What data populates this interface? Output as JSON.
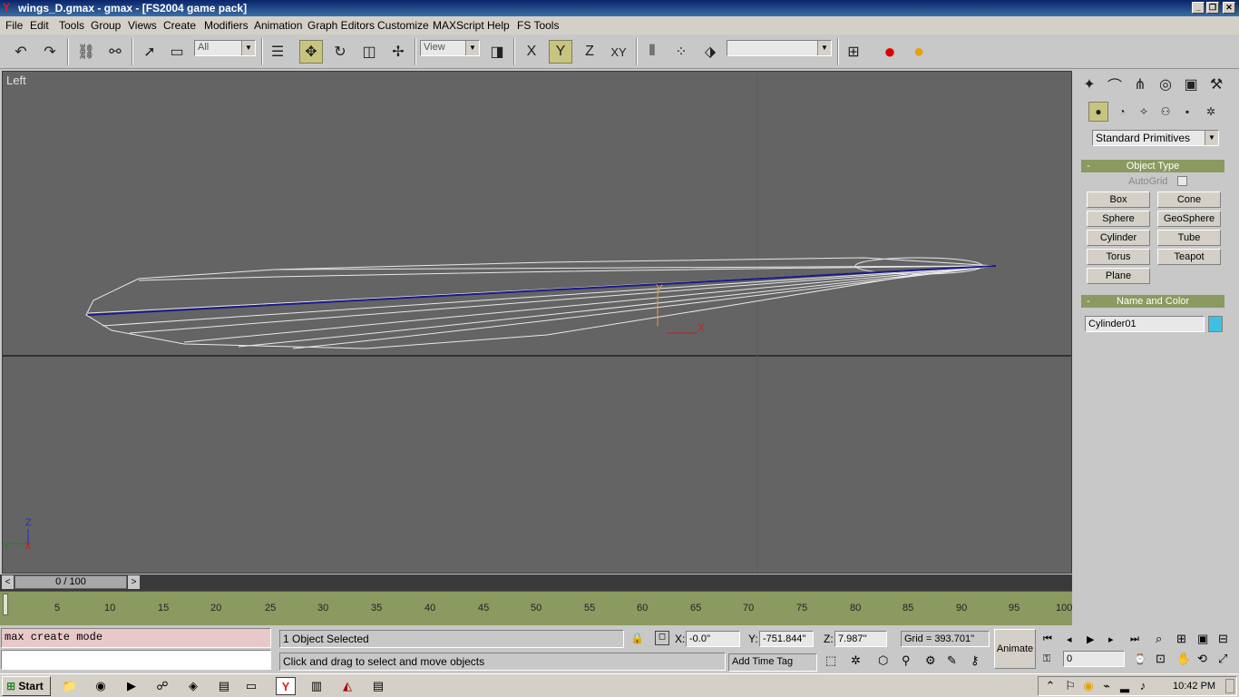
{
  "window": {
    "title": "wings_D.gmax - gmax - [FS2004 game pack]",
    "min_btn": "_",
    "max_btn": "❐",
    "close_btn": "✕"
  },
  "menu": [
    "File",
    "Edit",
    "Tools",
    "Group",
    "Views",
    "Create",
    "Modifiers",
    "Animation",
    "Graph Editors",
    "Customize",
    "MAXScript",
    "Help",
    "FS Tools"
  ],
  "toolbar": {
    "selection_filter": "All",
    "ref_coord": "View",
    "named_selection": "",
    "axis_x": "X",
    "axis_y": "Y",
    "axis_z": "Z",
    "axis_xy": "XY"
  },
  "viewport": {
    "label": "Left",
    "gizmo_y": "Y",
    "gizmo_x": "X",
    "axis_z": "Z",
    "axis_x": "X",
    "axis_y": "Y"
  },
  "command_panel": {
    "category_dropdown": "Standard Primitives",
    "object_type_header": "Object Type",
    "autogrid_label": "AutoGrid",
    "buttons": [
      "Box",
      "Cone",
      "Sphere",
      "GeoSphere",
      "Cylinder",
      "Tube",
      "Torus",
      "Teapot",
      "Plane"
    ],
    "name_color_header": "Name and Color",
    "object_name": "Cylinder01",
    "object_color": "#40c0e0",
    "collapse": "-"
  },
  "time": {
    "slider_text": "0 / 100",
    "prev": "<",
    "next": ">",
    "ticks": [
      "5",
      "10",
      "15",
      "20",
      "25",
      "30",
      "35",
      "40",
      "45",
      "50",
      "55",
      "60",
      "65",
      "70",
      "75",
      "80",
      "85",
      "90",
      "95",
      "100"
    ]
  },
  "status": {
    "listener_text": "max create mode",
    "selection_info": "1 Object Selected",
    "prompt": "Click and drag to select and move objects",
    "x_label": "X:",
    "x_value": "-0.0''",
    "y_label": "Y:",
    "y_value": "-751.844''",
    "z_label": "Z:",
    "z_value": "7.987''",
    "grid": "Grid = 393.701''",
    "add_time_tag": "Add Time Tag",
    "animate": "Animate",
    "frame": "0"
  },
  "taskbar": {
    "start": "Start",
    "clock": "10:42 PM"
  },
  "colors": {
    "viewport_bg": "#646464",
    "trackbar": "#8a9a60",
    "active_tool": "#c8c480"
  }
}
